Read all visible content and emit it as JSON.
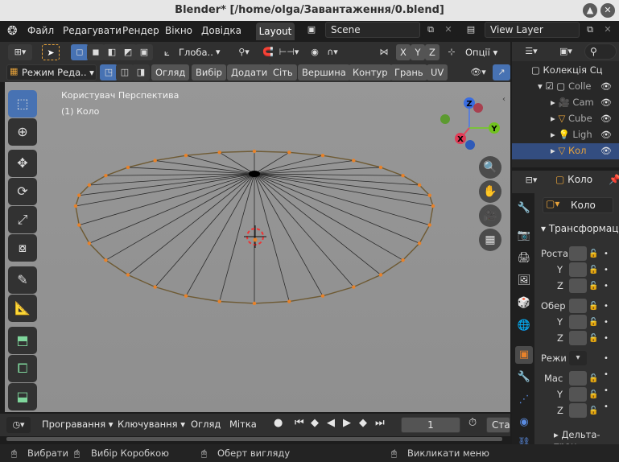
{
  "window": {
    "title": "Blender* [/home/olga/Завантаження/0.blend]",
    "minimize_icon": "chevron-up",
    "close_icon": "close"
  },
  "menu": {
    "items": [
      "Файл",
      "Редагувати",
      "Рендер",
      "Вікно",
      "Довідка"
    ]
  },
  "workspace": {
    "tab": "Layout",
    "scene": "Scene",
    "view_layer": "View Layer"
  },
  "header": {
    "orientation": "Глоба..",
    "axes": [
      "X",
      "Y",
      "Z"
    ],
    "options": "Опції"
  },
  "mode_bar": {
    "mode": "Режим Реда..",
    "menus": [
      "Огляд",
      "Вибір",
      "Додати",
      "Сіть",
      "Вершина",
      "Контур",
      "Грань",
      "UV"
    ]
  },
  "viewport": {
    "view_name": "Користувач Перспектива",
    "object_info": "(1) Коло",
    "gizmo_axes": [
      "Z",
      "Y",
      "X"
    ],
    "colors": {
      "edge": "#6e5a33",
      "vertex": "#e8822a",
      "background": "#939393"
    }
  },
  "outliner": {
    "collection": "Колекція Сц",
    "items": [
      "Colle",
      "Cam",
      "Cube",
      "Ligh",
      "Кол"
    ]
  },
  "properties": {
    "object_name_header": "Коло",
    "object_name": "Коло",
    "section": "Трансформац",
    "location_label": "Роста",
    "rotation_label": "Обер",
    "mode_label": "Режи",
    "scale_label": "Мас",
    "y": "Y",
    "z": "Z",
    "delta": "Дельта-тран"
  },
  "timeline": {
    "playback": "Програвання",
    "keying": "Ключування",
    "view": "Огляд",
    "marker": "Мітка",
    "frame": "1",
    "start": "Ста"
  },
  "status": {
    "select": "Вибрати",
    "box_select": "Вибір Коробкою",
    "rotate_view": "Оберт вигляду",
    "context_menu": "Викликати меню"
  }
}
